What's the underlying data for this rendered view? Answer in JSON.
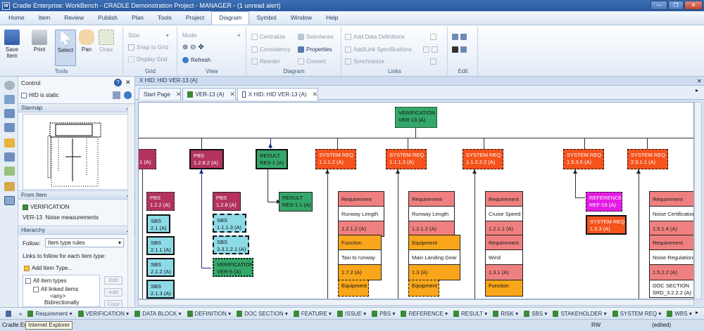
{
  "window": {
    "title": "Cradle Enterprise: WorkBench - CRADLE Demonstration Project - MANAGER - (1 unread alert)",
    "app_letter": "W"
  },
  "menu": [
    "Home",
    "Item",
    "Review",
    "Publish",
    "Plan",
    "Tools",
    "Project",
    "Diagram",
    "Symbol",
    "Window",
    "Help"
  ],
  "ribbon": {
    "save": "Save Item",
    "print": "Print",
    "select": "Select",
    "pan": "Pan",
    "draw": "Draw",
    "tools_label": "Tools",
    "size": "Size:",
    "snap": "Snap to Grid",
    "display_grid": "Display Grid",
    "grid_label": "Grid",
    "mode": "Mode:",
    "refresh": "Refresh",
    "view_label": "View",
    "centralize": "Centralize",
    "consistency": "Consistency",
    "reorder": "Reorder",
    "swimlanes": "Swimlanes",
    "properties": "Properties",
    "convert": "Convert",
    "diagram_label": "Diagram",
    "add_defs": "Add Data Definitions",
    "add_links": "Add/Link Specifications",
    "synchronize": "Synchronize",
    "links_label": "Links",
    "edit_label": "Edit"
  },
  "left": {
    "control": "Control",
    "hid_static": "HID is static",
    "starmap": "Starmap",
    "from_item": "From Item",
    "from_type": "VERIFICATION",
    "from_id": "VER-13",
    "from_name": "Noise measurements",
    "hierarchy": "Hierarchy",
    "follow_label": "Follow:",
    "follow_value": "Item type rules",
    "links_follow": "Links to follow for each item type:",
    "add_item_type": "Add Item Type...",
    "all_item_types": "All item types",
    "all_linked": "All linked items",
    "any": "<any>",
    "bidir": "Bidirectionally",
    "edit": "Edit",
    "add": "Add",
    "copy": "Copy"
  },
  "doc": {
    "header": "X HID: HID VER-13 (A)",
    "tabs": [
      {
        "label": "Start Page"
      },
      {
        "label": "VER-13 (A)"
      },
      {
        "label": "X HID: HID VER-13 (A)"
      }
    ]
  },
  "diagram": {
    "root": {
      "type": "VERIFICATION",
      "id": "VER-13 (A)"
    },
    "level1": [
      {
        "type": "",
        "id": ".1 (A)"
      },
      {
        "type": "PBS",
        "id": "1.2.8.2 (A)"
      },
      {
        "type": "RESULT",
        "id": "RES-1 (A)"
      },
      {
        "type": "SYSTEM REQ",
        "id": "1.1.1.2 (A)"
      },
      {
        "type": "SYSTEM REQ",
        "id": "1.1.1.3 (A)"
      },
      {
        "type": "SYSTEM REQ",
        "id": "1.1.2.2.2 (A)"
      },
      {
        "type": "SYSTEM REQ",
        "id": "1.5.3.5 (A)"
      },
      {
        "type": "SYSTEM REQ",
        "id": "2.3.1.1 (A)"
      }
    ],
    "col1": [
      {
        "type": "PBS",
        "id": "1.2.2 (A)"
      },
      {
        "type": "SBS",
        "id": "2.1 (A)"
      },
      {
        "type": "SBS",
        "id": "2.1.1 (A)"
      },
      {
        "type": "SBS",
        "id": "2.1.2 (A)"
      },
      {
        "type": "SBS",
        "id": "2.1.3 (A)"
      }
    ],
    "col2": [
      {
        "type": "PBS",
        "id": "1.2.8 (A)"
      },
      {
        "type": "SBS",
        "id": "1.1.1.3 (A)"
      },
      {
        "type": "SBS",
        "id": "3.3.1.2.1 (A)"
      },
      {
        "type": "VERIFICATION",
        "id": "VER-5 (A)"
      }
    ],
    "result_child": {
      "type": "RESULT",
      "id": "RES-1.1 (A)"
    },
    "req1": {
      "kind": "Requirement",
      "name": "Runway Length",
      "id": "1.2.1.2 (A)",
      "f_kind": "Function",
      "f_name": "Taxi to runway",
      "f_id": "1.7.2 (A)",
      "e_kind": "Equipment"
    },
    "req2": {
      "kind": "Requirement",
      "name": "Runway Length",
      "id": "1.2.1.2 (A)",
      "f_kind": "Equipment",
      "f_name": "Main Landing Gear",
      "f_id": "1.3 (A)",
      "e_kind": "Equipment"
    },
    "req3": {
      "kind": "Requirement",
      "name": "Cruise Speed",
      "id": "1.2.1.1 (A)",
      "f_kind": "Requirement",
      "f_name": "Wind",
      "f_id": "1.3.1 (A)",
      "e_kind": "Function"
    },
    "ref": {
      "type": "REFERENCE",
      "id": "REF-16 (A)"
    },
    "sys_child": {
      "type": "SYSTEM REQ",
      "id": "1.5.3 (A)"
    },
    "req5": {
      "kind": "Requirement",
      "name": "Noise Certification",
      "id": "1.5.1.4 (A)",
      "k2": "Requirement",
      "n2": "Noise Regulations",
      "i2": "1.5.2.2 (A)",
      "doc": "DOC SECTION",
      "doc_id": "SRD_3.2.2.2 (A)"
    }
  },
  "typebar": [
    "Requirement",
    "VERIFICATION",
    "DATA BLOCK",
    "DEFINITION",
    "DOC SECTION",
    "FEATURE",
    "ISSUE",
    "PBS",
    "REFERENCE",
    "RESULT",
    "RISK",
    "SBS",
    "STAKEHOLDER",
    "SYSTEM REQ",
    "WBS"
  ],
  "status": {
    "left": "Cradle En",
    "tooltip": "Internet Explorer",
    "rw": "RW",
    "edited": "(edited)"
  }
}
